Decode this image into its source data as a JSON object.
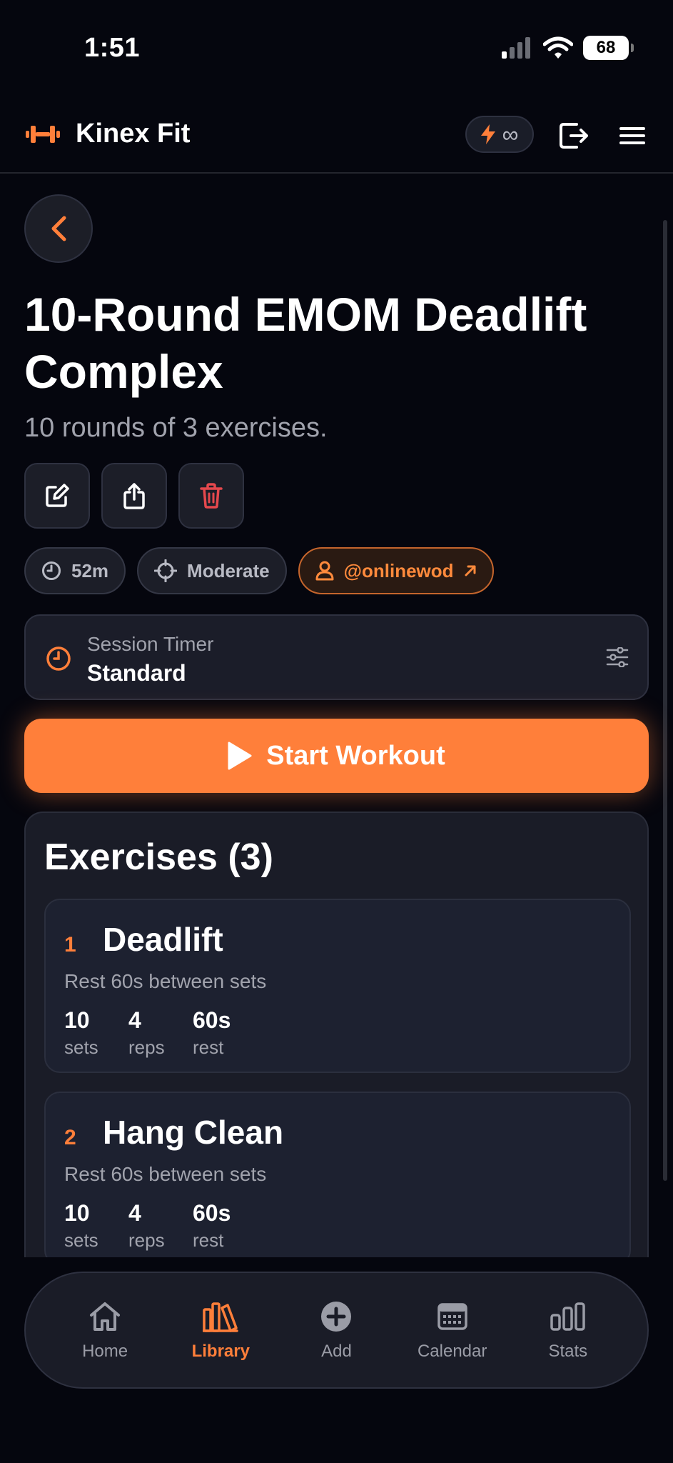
{
  "status_bar": {
    "time": "1:51",
    "battery": "68"
  },
  "header": {
    "app_name": "Kinex Fit",
    "credits": "∞"
  },
  "workout": {
    "title": "10-Round EMOM Deadlift Complex",
    "subtitle": "10 rounds of 3 exercises.",
    "duration": "52m",
    "difficulty": "Moderate",
    "author": "@onlinewod"
  },
  "session_timer": {
    "label": "Session Timer",
    "value": "Standard"
  },
  "start_button": {
    "label": "Start Workout"
  },
  "exercises": {
    "heading": "Exercises (3)",
    "items": [
      {
        "number": "1",
        "name": "Deadlift",
        "note": "Rest 60s between sets",
        "sets": "10",
        "sets_label": "sets",
        "reps": "4",
        "reps_label": "reps",
        "rest": "60s",
        "rest_label": "rest"
      },
      {
        "number": "2",
        "name": "Hang Clean",
        "note": "Rest 60s between sets",
        "sets": "10",
        "sets_label": "sets",
        "reps": "4",
        "reps_label": "reps",
        "rest": "60s",
        "rest_label": "rest"
      }
    ]
  },
  "bottom_nav": {
    "items": [
      {
        "label": "Home",
        "icon": "home-icon"
      },
      {
        "label": "Library",
        "icon": "library-icon",
        "active": true
      },
      {
        "label": "Add",
        "icon": "add-icon"
      },
      {
        "label": "Calendar",
        "icon": "calendar-icon"
      },
      {
        "label": "Stats",
        "icon": "stats-icon"
      }
    ]
  },
  "colors": {
    "accent": "#ff7f3a",
    "background": "#05060e",
    "card": "#1a1c27",
    "danger": "#e5484d"
  }
}
